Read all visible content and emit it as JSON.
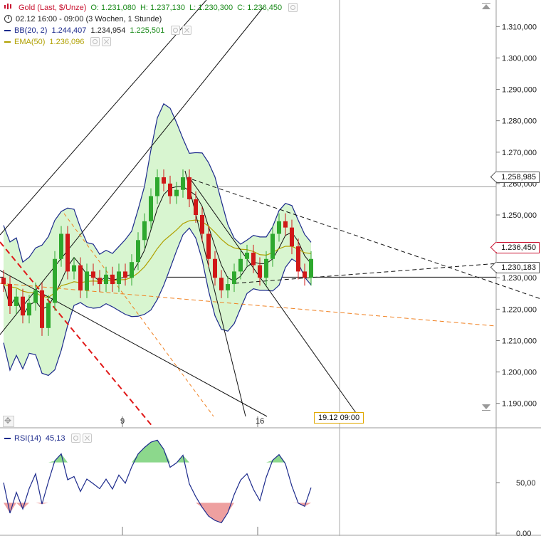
{
  "legend": {
    "symbol": "Gold (Last, $/Unze)",
    "open": "O: 1.231,080",
    "high": "H: 1.237,130",
    "low": "L: 1.230,300",
    "close": "C: 1.236,450",
    "period": "02.12 16:00 - 09:00 (3 Wochen, 1 Stunde)",
    "bb_label": "BB(20, 2)",
    "bb_upper": "1.244,407",
    "bb_mid": "1.234,954",
    "bb_lower": "1.225,501",
    "ema_label": "EMA(50)",
    "ema_value": "1.236,096",
    "rsi_label": "RSI(14)",
    "rsi_value": "45,13"
  },
  "colors": {
    "up": "#2ea82e",
    "down": "#d01818",
    "bb": "#1c2a8c",
    "bb_fill": "#d8f5d0",
    "ema": "#b0a000",
    "rsi": "#1c2a8c",
    "rsi_hi_fill": "#8cd88c",
    "rsi_lo_fill": "#eea0a0",
    "trend_dashed_orange": "#f08020",
    "trend_dashed_red": "#e01818",
    "symbol_red": "#c8102e",
    "green_text": "#1a8a1a"
  },
  "badges": {
    "b1": "1.258,985",
    "b2": "1.236,450",
    "b3": "1.230,183"
  },
  "crosshair_label": "19.12 09:00",
  "chart_data": [
    {
      "type": "candlestick",
      "title": "Gold (Last, $/Unze)",
      "y_ticks": [
        "1.190,000",
        "1.200,000",
        "1.210,000",
        "1.220,000",
        "1.230,000",
        "1.240,000",
        "1.250,000",
        "1.260,000",
        "1.270,000",
        "1.280,000",
        "1.290,000",
        "1.300,000",
        "1.310,000"
      ],
      "y_values": [
        1190,
        1200,
        1210,
        1220,
        1230,
        1240,
        1250,
        1260,
        1270,
        1280,
        1290,
        1300,
        1310
      ],
      "ylim": [
        1182,
        1318
      ],
      "x_ticks": [
        "9",
        "16"
      ],
      "horizontal_lines": [
        1258.985,
        1230.183
      ],
      "close_path": [
        1228,
        1221,
        1224,
        1218,
        1222,
        1226,
        1214,
        1222,
        1236,
        1244,
        1232,
        1234,
        1226,
        1232,
        1230,
        1228,
        1231,
        1228,
        1232,
        1230,
        1235,
        1242,
        1248,
        1256,
        1262,
        1260,
        1256,
        1258,
        1262,
        1255,
        1250,
        1244,
        1236,
        1230,
        1226,
        1228,
        1232,
        1236,
        1238,
        1234,
        1230,
        1236,
        1244,
        1248,
        1246,
        1240,
        1232,
        1230,
        1236
      ]
    },
    {
      "type": "line",
      "title": "RSI(14)",
      "y_ticks": [
        "0,00",
        "50,00"
      ],
      "y_values": [
        0,
        50
      ],
      "ylim": [
        0,
        100
      ],
      "last": 45.13
    }
  ]
}
